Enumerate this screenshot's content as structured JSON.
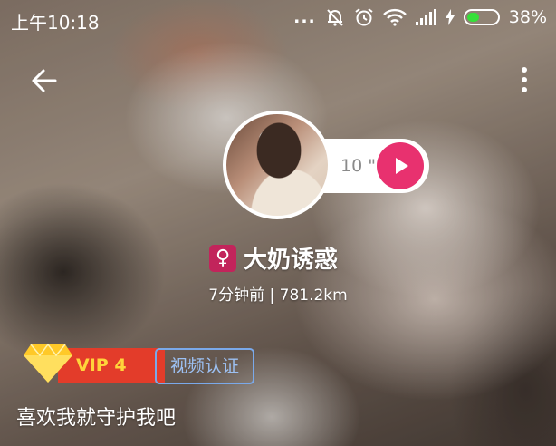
{
  "status_bar": {
    "time": "上午10:18",
    "dots": "...",
    "battery_percent": "38%",
    "battery_level": 0.38,
    "icons": [
      "mute-bell-icon",
      "alarm-icon",
      "wifi-icon",
      "signal-icon",
      "charging-icon",
      "battery-icon"
    ]
  },
  "nav": {
    "back_icon": "arrow-left-icon",
    "more_icon": "more-vertical-icon"
  },
  "profile": {
    "voice_duration": "10 \"",
    "gender_symbol": "♀",
    "name": "大奶诱惑",
    "meta": "7分钟前 | 781.2km",
    "vip_label": "VIP 4",
    "video_cert_label": "视频认证",
    "slogan": "喜欢我就守护我吧"
  },
  "colors": {
    "accent_pink": "#e8316f",
    "gender_badge": "#c2245b",
    "vip_red": "#e33c2a",
    "vip_gold": "#ffd43b",
    "cert_blue": "#7aa9ea",
    "battery_green": "#36e03a"
  }
}
